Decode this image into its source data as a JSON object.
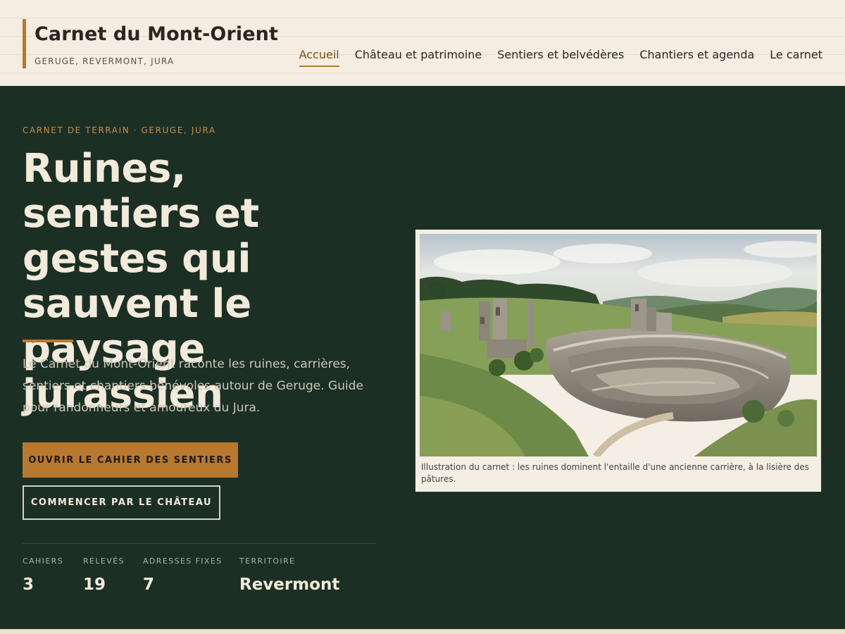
{
  "site": {
    "title": "Carnet du Mont-Orient",
    "subtitle": "GERUGE, REVERMONT, JURA"
  },
  "nav": {
    "items": [
      {
        "label": "Accueil",
        "active": true
      },
      {
        "label": "Château et patrimoine"
      },
      {
        "label": "Sentiers et belvédères"
      },
      {
        "label": "Chantiers et agenda"
      },
      {
        "label": "Le carnet"
      }
    ]
  },
  "hero": {
    "eyebrow": "CARNET DE TERRAIN · GERUGE, JURA",
    "title": "Ruines, sentiers et gestes qui sauvent le paysage jurassien",
    "lead": "Le Carnet du Mont-Orient raconte les ruines, carrières, sentiers et chantiers bénévoles autour de Geruge. Guide pour randonneurs et amoureux du Jura.",
    "primary_cta": "OUVRIR LE CAHIER DES SENTIERS",
    "secondary_cta": "COMMENCER PAR LE CHÂTEAU"
  },
  "stats": [
    {
      "label": "CAHIERS",
      "value": "3"
    },
    {
      "label": "RELEVÉS",
      "value": "19"
    },
    {
      "label": "ADRESSES FIXES",
      "value": "7"
    },
    {
      "label": "TERRITOIRE",
      "value": "Revermont"
    }
  ],
  "figure": {
    "caption": "Illustration du carnet : les ruines dominent l'entaille d'une ancienne carrière, à la lisière des pâtures."
  },
  "colors": {
    "accent": "#b8782f",
    "hero_bg": "#1c2f25",
    "paper": "#f5ede1",
    "hero_text": "#f2eadb"
  }
}
